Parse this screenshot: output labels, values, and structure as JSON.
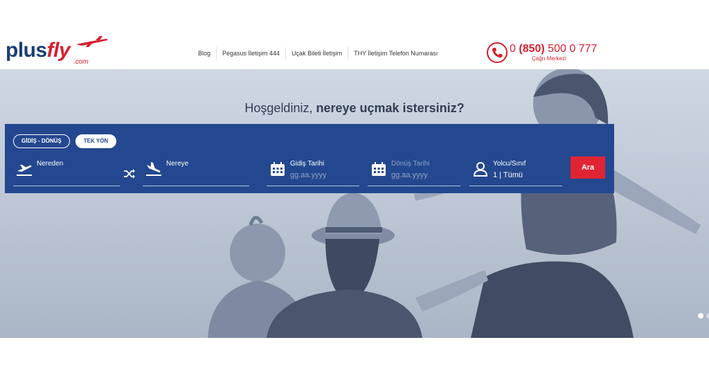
{
  "logo": {
    "part1": "plus",
    "part2": "fly",
    "suffix": ".com"
  },
  "nav": [
    {
      "label": "Blog"
    },
    {
      "label": "Pegasus İletişim 444"
    },
    {
      "label": "Uçak Bileti İletişim"
    },
    {
      "label": "THY İletişim Telefon Numarası"
    }
  ],
  "phone": {
    "prefix": "0",
    "area": "(850)",
    "rest": "500 0 777",
    "sub": "Çağrı Merkezi"
  },
  "hero": {
    "welcome_plain": "Hoşgeldiniz,",
    "welcome_bold": "nereye uçmak istersiniz?"
  },
  "search": {
    "trip_round": "GİDİŞ - DÖNÜŞ",
    "trip_oneway": "TEK YÖN",
    "from_label": "Nereden",
    "to_label": "Nereye",
    "depart_label": "Gidiş Tarihi",
    "depart_placeholder": "gg.aa.yyyy",
    "return_label": "Dönüş Tarihi",
    "return_placeholder": "gg.aa.yyyy",
    "pax_label": "Yolcu/Sınıf",
    "pax_value": "1 | Tümü",
    "submit": "Ara"
  },
  "colors": {
    "brand_navy": "#1b3f73",
    "brand_red": "#d3202f",
    "panel_blue": "#24488f",
    "button_red": "#e02433"
  },
  "slider": {
    "total": 2,
    "active": 1
  }
}
